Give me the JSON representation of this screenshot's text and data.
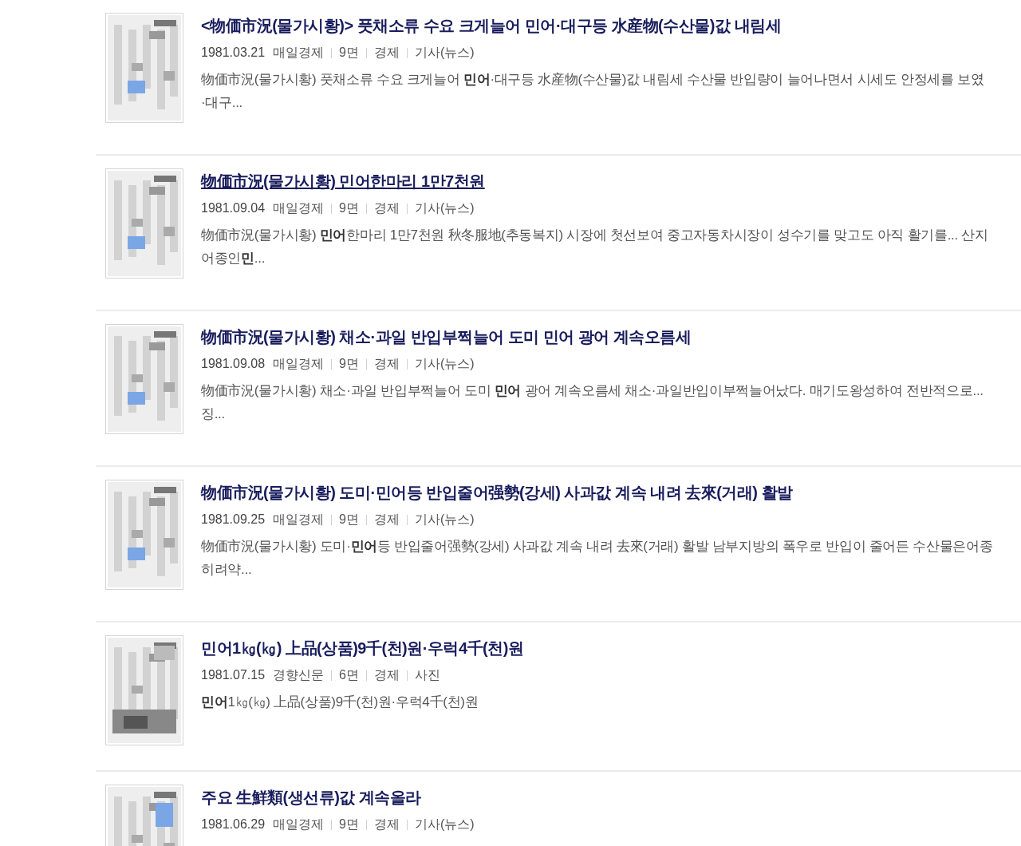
{
  "results": [
    {
      "title": "<物価市況(물가시황)> 풋채소류 수요 크게늘어 민어·대구등 水産物(수산물)값 내림세",
      "underlined": false,
      "date": "1981.03.21",
      "source": "매일경제",
      "page": "9면",
      "section": "경제",
      "type": "기사(뉴스)",
      "summary_lines": [
        "物価市況(물가시황) 풋채소류 수요 크게늘어 **민어**·대구등 水産物(수산물)값 내림세 수산물 반입량이 늘어나면서 시세도 안정세를 보였",
        "·대구..."
      ]
    },
    {
      "title": "物価市況(물가시황) 민어한마리 1만7천원",
      "underlined": true,
      "date": "1981.09.04",
      "source": "매일경제",
      "page": "9면",
      "section": "경제",
      "type": "기사(뉴스)",
      "summary_lines": [
        "物価市況(물가시황) **민어**한마리 1만7천원 秋冬服地(추동복지) 시장에 첫선보여 중고자동차시장이 성수기를 맞고도 아직 활기를... 산지",
        "어종인**민**..."
      ]
    },
    {
      "title": "物価市況(물가시황) 채소·과일 반입부쩍늘어 도미 민어 광어 계속오름세",
      "underlined": false,
      "date": "1981.09.08",
      "source": "매일경제",
      "page": "9면",
      "section": "경제",
      "type": "기사(뉴스)",
      "summary_lines": [
        "物価市況(물가시황) 채소·과일 반입부쩍늘어 도미 **민어** 광어 계속오름세 채소·과일반입이부쩍늘어났다. 매기도왕성하여 전반적으로...",
        "징..."
      ]
    },
    {
      "title": "物価市況(물가시황) 도미·민어등 반입줄어强勢(강세) 사과값 계속 내려 去來(거래) 활발",
      "underlined": false,
      "date": "1981.09.25",
      "source": "매일경제",
      "page": "9면",
      "section": "경제",
      "type": "기사(뉴스)",
      "summary_lines": [
        "物価市況(물가시황) 도미·**민어**등 반입줄어强勢(강세) 사과값 계속 내려 去來(거래) 활발 남부지방의 폭우로 반입이 줄어든 수산물은어종",
        "히려약..."
      ]
    },
    {
      "title": "민어1㎏(㎏) 上品(상품)9千(천)원·우럭4千(천)원",
      "underlined": false,
      "date": "1981.07.15",
      "source": "경향신문",
      "page": "6면",
      "section": "경제",
      "type": "사진",
      "summary_lines": [
        "**민어**1㎏(㎏) 上品(상품)9千(천)원·우럭4千(천)원"
      ]
    },
    {
      "title": "주요 生鮮類(생선류)값 계속올라",
      "underlined": false,
      "date": "1981.06.29",
      "source": "매일경제",
      "page": "9면",
      "section": "경제",
      "type": "기사(뉴스)"
    }
  ]
}
